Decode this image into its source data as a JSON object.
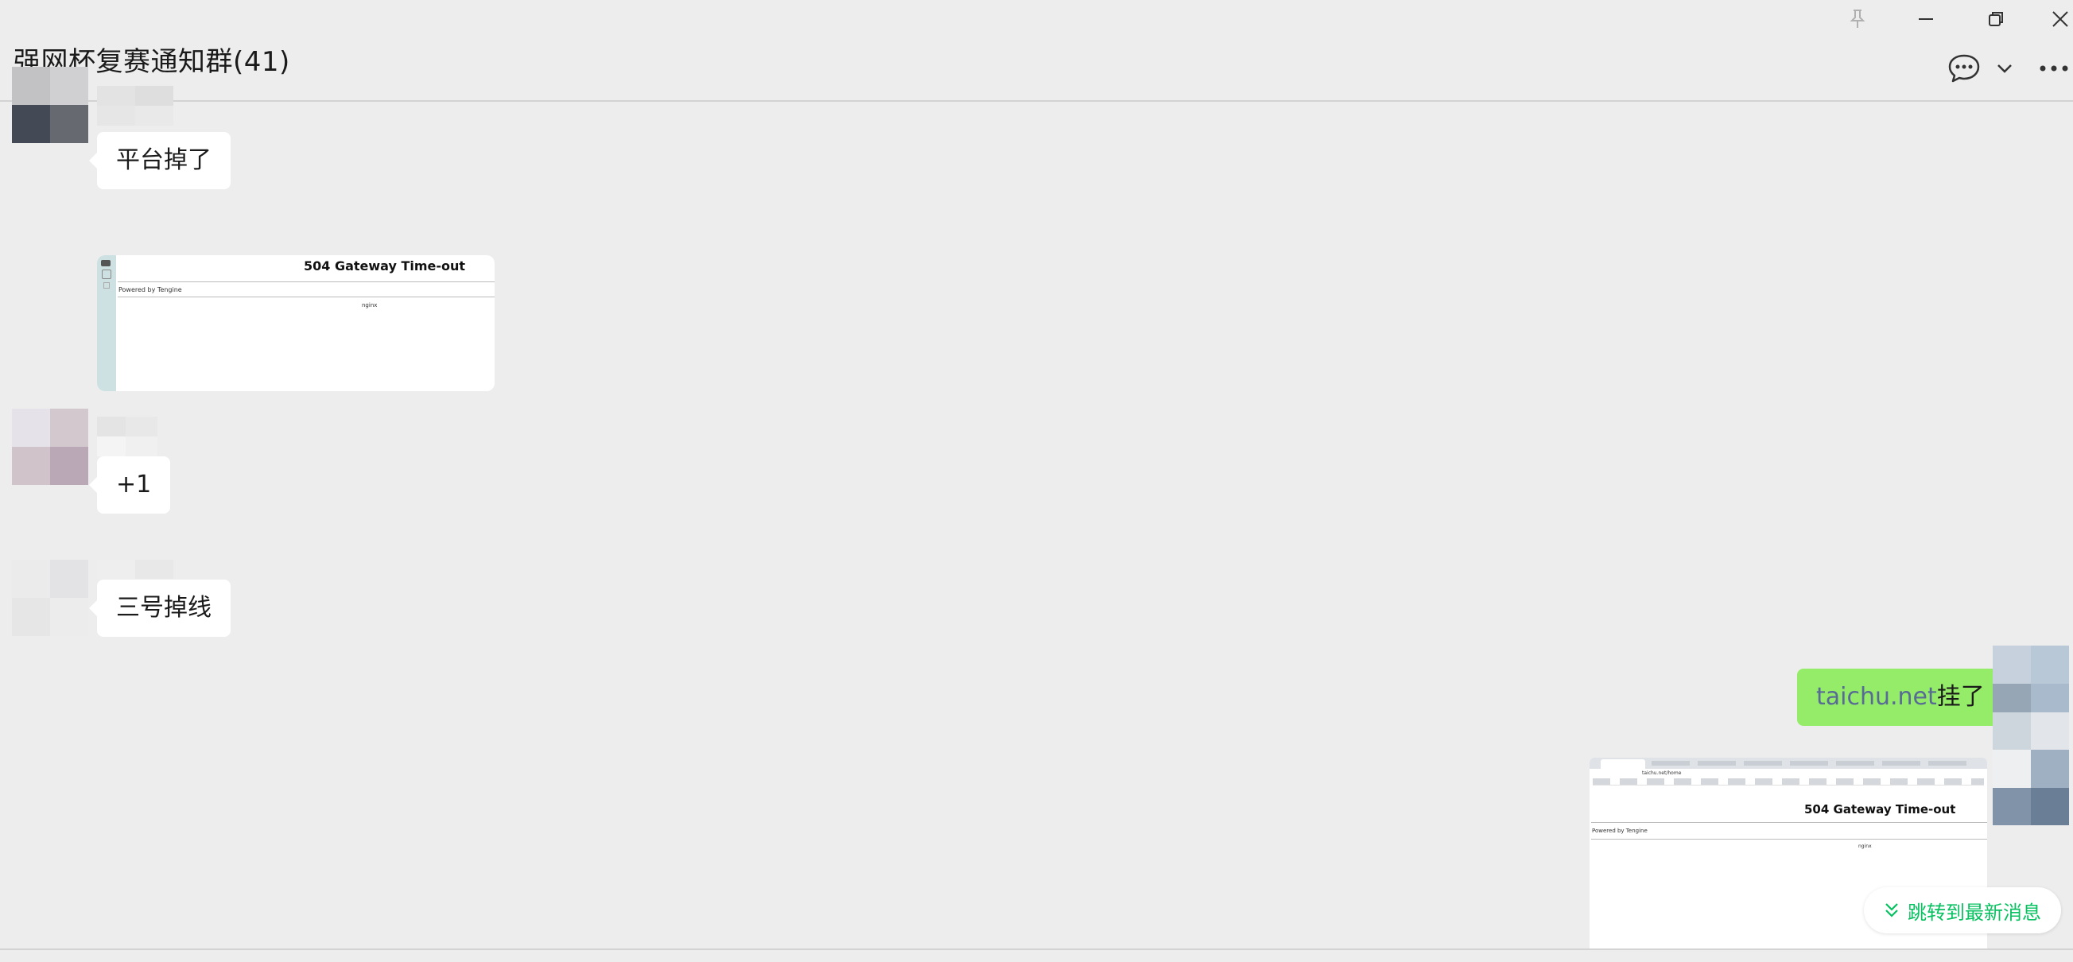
{
  "window": {
    "pin_icon": "pin-icon",
    "minimize_icon": "minimize-icon",
    "restore_icon": "restore-icon",
    "close_icon": "close-icon"
  },
  "header": {
    "title": "强网杯复赛通知群(41)",
    "chat_icon": "chat-bubble-icon",
    "dropdown_icon": "chevron-down-icon",
    "more_icon": "more-icon"
  },
  "messages": [
    {
      "type": "text",
      "text": "平台掉了"
    },
    {
      "type": "image",
      "heading": "504 Gateway Time-out",
      "footer_left": "Powered by Tengine",
      "footer_center": "nginx"
    },
    {
      "type": "text",
      "text": "+1"
    },
    {
      "type": "text",
      "text": "三号掉线"
    },
    {
      "type": "self-text",
      "link": "taichu.net",
      "text": "挂了"
    },
    {
      "type": "self-image",
      "url": "taichu.net/home",
      "heading": "504 Gateway Time-out",
      "footer_left": "Powered by Tengine",
      "footer_center": "nginx"
    }
  ],
  "jump_button": {
    "label": "跳转到最新消息",
    "icon": "double-chevron-down-icon"
  },
  "colors": {
    "background": "#ededed",
    "self_bubble": "#95ec69",
    "other_bubble": "#ffffff",
    "link": "#576b95",
    "accent_green": "#07c160"
  }
}
